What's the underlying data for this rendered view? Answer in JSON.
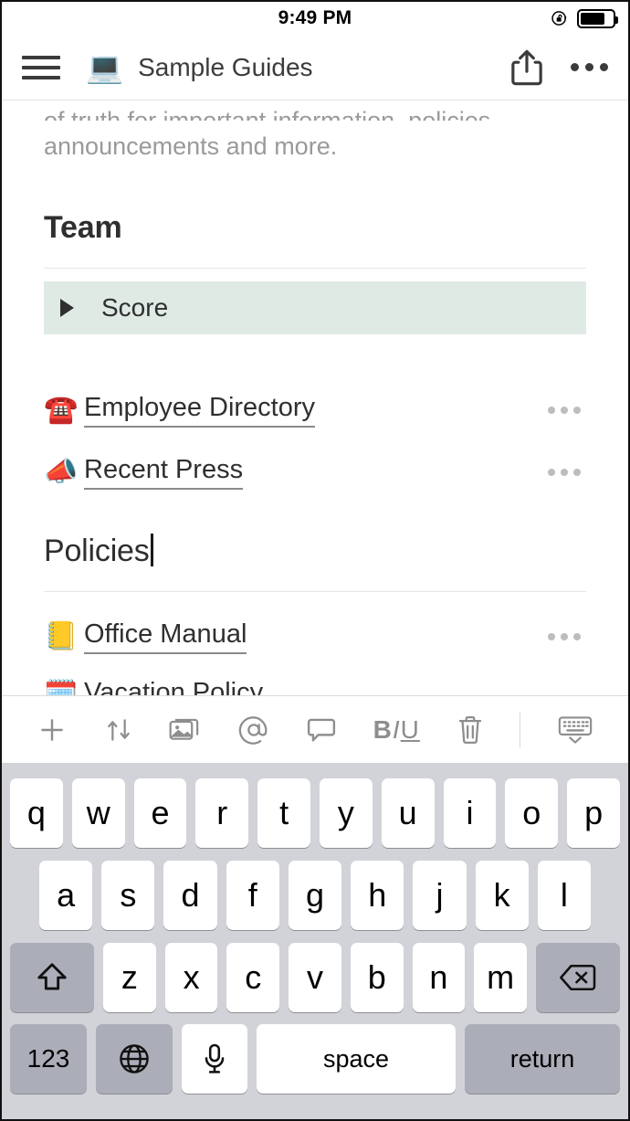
{
  "status_bar": {
    "time": "9:49 PM",
    "rotation_lock_icon": "rotation-lock-icon",
    "battery_icon": "battery-icon",
    "battery_level_percent": 75
  },
  "nav": {
    "menu_icon": "hamburger-menu-icon",
    "page_emoji": "💻",
    "title": "Sample Guides",
    "share_icon": "share-icon",
    "overflow_icon": "more-options-icon"
  },
  "document": {
    "clipped_paragraph_top": "of truth for important information, policies,",
    "paragraph": "announcements and more.",
    "sections": [
      {
        "heading": "Team",
        "editing": false,
        "toggle": {
          "label": "Score",
          "expanded": false,
          "highlight_color": "#dfeae5"
        },
        "links": [
          {
            "emoji": "☎️",
            "label": "Employee Directory"
          },
          {
            "emoji": "📣",
            "label": "Recent Press"
          }
        ]
      },
      {
        "heading": "Policies",
        "editing": true,
        "links": [
          {
            "emoji": "📒",
            "label": "Office Manual"
          }
        ],
        "clipped_link": "Vacation Policy"
      }
    ]
  },
  "editor_toolbar": {
    "items": [
      {
        "name": "add-block-button",
        "icon": "plus-icon"
      },
      {
        "name": "move-block-button",
        "icon": "up-down-arrows-icon"
      },
      {
        "name": "insert-image-button",
        "icon": "photo-icon"
      },
      {
        "name": "mention-button",
        "icon": "at-sign-icon"
      },
      {
        "name": "comment-button",
        "icon": "comment-bubble-icon"
      },
      {
        "name": "text-format-button",
        "icon": "bold-italic-underline-icon",
        "label": "BIU"
      },
      {
        "name": "delete-button",
        "icon": "trash-icon"
      },
      {
        "name": "dismiss-keyboard-button",
        "icon": "hide-keyboard-icon"
      }
    ]
  },
  "keyboard": {
    "row1": [
      "q",
      "w",
      "e",
      "r",
      "t",
      "y",
      "u",
      "i",
      "o",
      "p"
    ],
    "row2": [
      "a",
      "s",
      "d",
      "f",
      "g",
      "h",
      "j",
      "k",
      "l"
    ],
    "row3": [
      "z",
      "x",
      "c",
      "v",
      "b",
      "n",
      "m"
    ],
    "shift_icon": "shift-arrow-icon",
    "backspace_icon": "backspace-icon",
    "numbers_key": "123",
    "globe_icon": "globe-language-icon",
    "mic_icon": "microphone-icon",
    "space_key": "space",
    "return_key": "return"
  }
}
